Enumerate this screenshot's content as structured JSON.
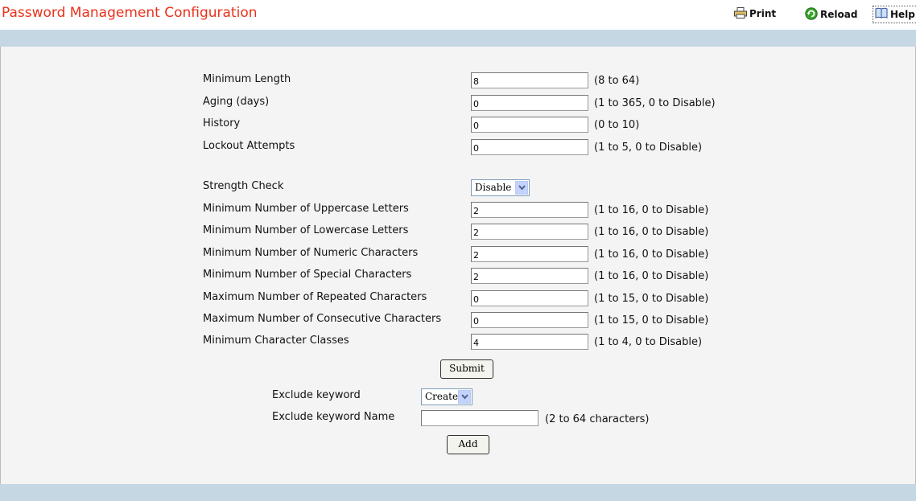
{
  "page": {
    "title": "Password Management Configuration",
    "print_label": "Print",
    "reload_label": "Reload",
    "help_label": "Help"
  },
  "fields": [
    {
      "label": "Minimum Length",
      "value": "8",
      "hint": "(8 to 64)"
    },
    {
      "label": "Aging (days)",
      "value": "0",
      "hint": "(1 to 365, 0 to Disable)"
    },
    {
      "label": "History",
      "value": "0",
      "hint": "(0 to 10)"
    },
    {
      "label": "Lockout Attempts",
      "value": "0",
      "hint": "(1 to 5, 0 to Disable)"
    }
  ],
  "strength": {
    "label": "Strength Check",
    "selected": "Disable"
  },
  "strength_fields": [
    {
      "label": "Minimum Number of Uppercase Letters",
      "value": "2",
      "hint": "(1 to 16, 0 to Disable)"
    },
    {
      "label": "Minimum Number of Lowercase Letters",
      "value": "2",
      "hint": "(1 to 16, 0 to Disable)"
    },
    {
      "label": "Minimum Number of Numeric Characters",
      "value": "2",
      "hint": "(1 to 16, 0 to Disable)"
    },
    {
      "label": "Minimum Number of Special Characters",
      "value": "2",
      "hint": "(1 to 16, 0 to Disable)"
    },
    {
      "label": "Maximum Number of Repeated Characters",
      "value": "0",
      "hint": "(1 to 15, 0 to Disable)"
    },
    {
      "label": "Maximum Number of Consecutive Characters",
      "value": "0",
      "hint": "(1 to 15, 0 to Disable)"
    },
    {
      "label": "Minimum Character Classes",
      "value": "4",
      "hint": "(1 to 4, 0 to Disable)"
    }
  ],
  "submit_label": "Submit",
  "exclude": {
    "keyword_label": "Exclude keyword",
    "keyword_selected": "Create",
    "name_label": "Exclude keyword Name",
    "name_value": "",
    "name_hint": "(2 to 64 characters)",
    "add_label": "Add"
  },
  "colors": {
    "title": "#e8321a",
    "bar": "#c5d7e3",
    "background": "#f4f4f4"
  }
}
